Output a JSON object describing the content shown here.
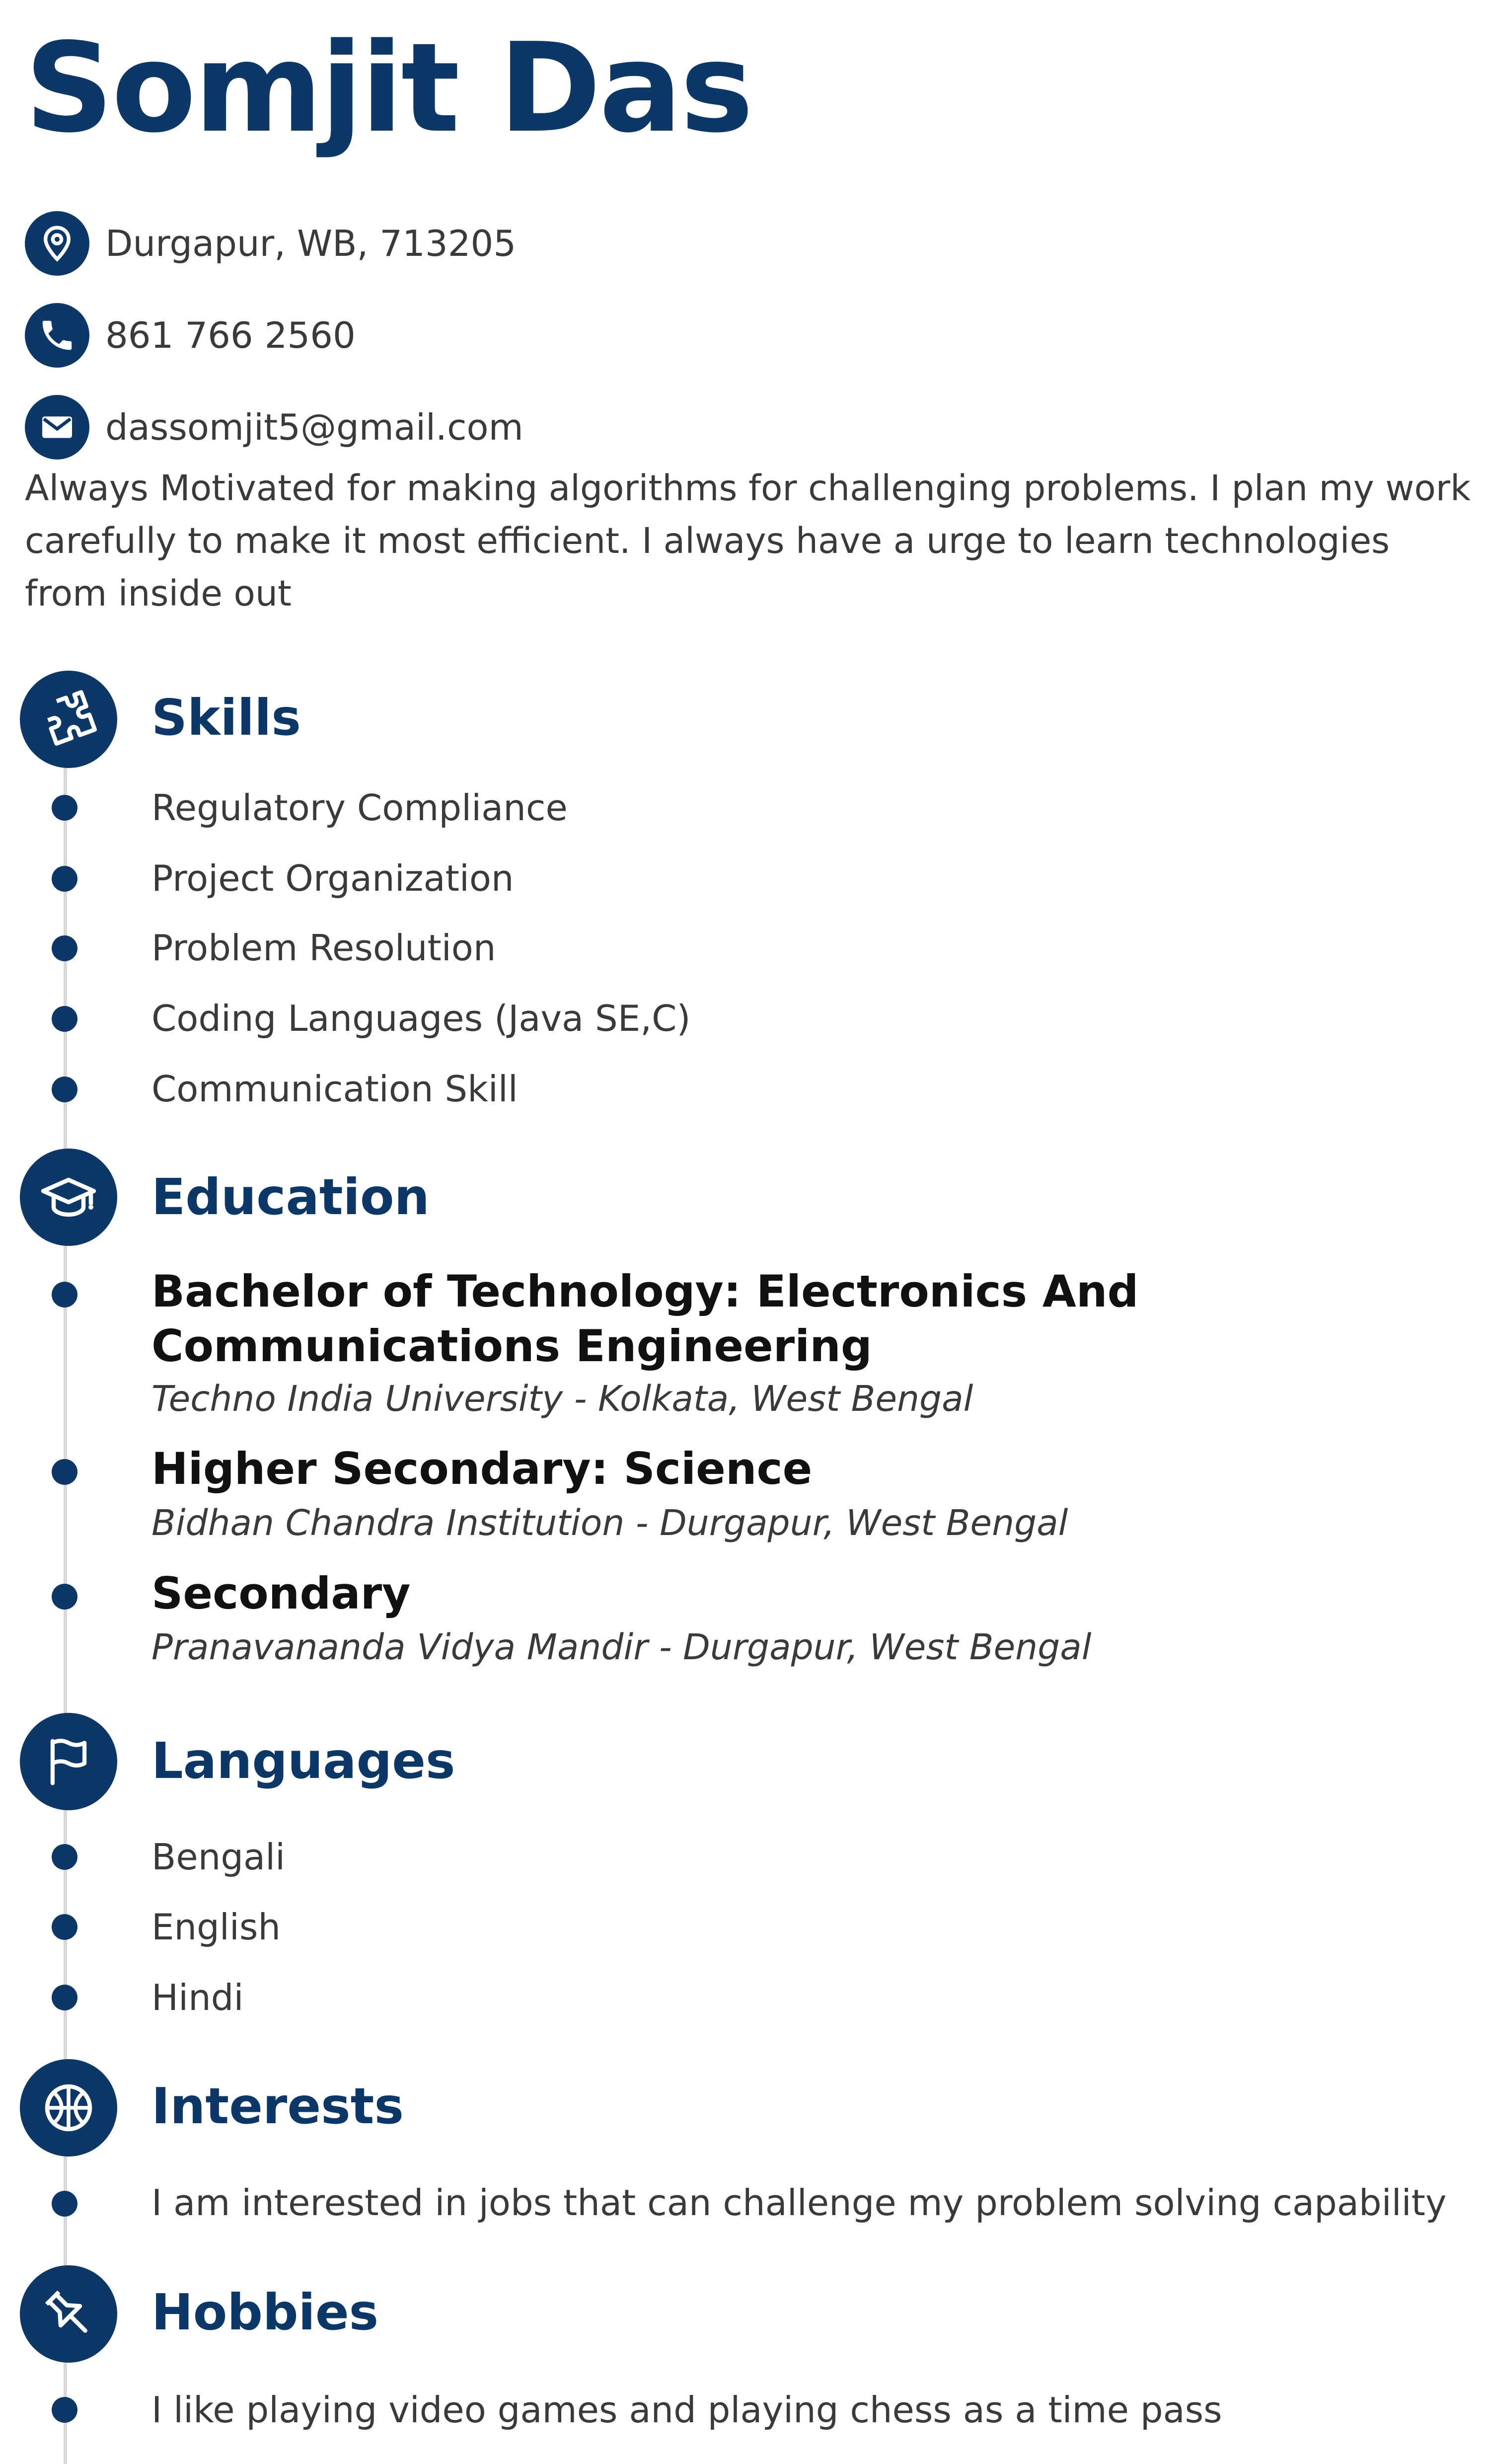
{
  "theme": {
    "accent": "#0d3766",
    "timeline": "#d8d8d8"
  },
  "header": {
    "name": "Somjit Das"
  },
  "contact": {
    "address": "Durgapur, WB, 713205",
    "phone": "861 766 2560",
    "email": "dassomjit5@gmail.com",
    "icons": [
      "location-pin-icon",
      "phone-icon",
      "envelope-icon"
    ]
  },
  "summary": "Always Motivated for making algorithms for challenging problems. I plan my work carefully to make it most efficient. I always have a urge to learn technologies from inside out",
  "sections": {
    "skills": {
      "title": "Skills",
      "icon": "puzzle-piece-icon",
      "items": [
        "Regulatory Compliance",
        "Project Organization",
        "Problem Resolution",
        "Coding Languages (Java SE,C)",
        "Communication Skill"
      ]
    },
    "education": {
      "title": "Education",
      "icon": "graduation-cap-icon",
      "entries": [
        {
          "degree": "Bachelor of Technology: Electronics And Communications Engineering",
          "school": "Techno India University - Kolkata, West Bengal"
        },
        {
          "degree": "Higher Secondary: Science",
          "school": "Bidhan Chandra Institution - Durgapur, West Bengal"
        },
        {
          "degree": "Secondary",
          "school": "Pranavananda Vidya Mandir - Durgapur, West Bengal"
        }
      ]
    },
    "languages": {
      "title": "Languages",
      "icon": "flag-icon",
      "items": [
        "Bengali",
        "English",
        "Hindi"
      ]
    },
    "interests": {
      "title": "Interests",
      "icon": "basketball-icon",
      "items": [
        "I am interested in jobs that can challenge my problem solving capability"
      ]
    },
    "hobbies": {
      "title": "Hobbies",
      "icon": "pushpin-icon",
      "items": [
        "I like playing video games and playing chess as a time pass"
      ]
    }
  }
}
